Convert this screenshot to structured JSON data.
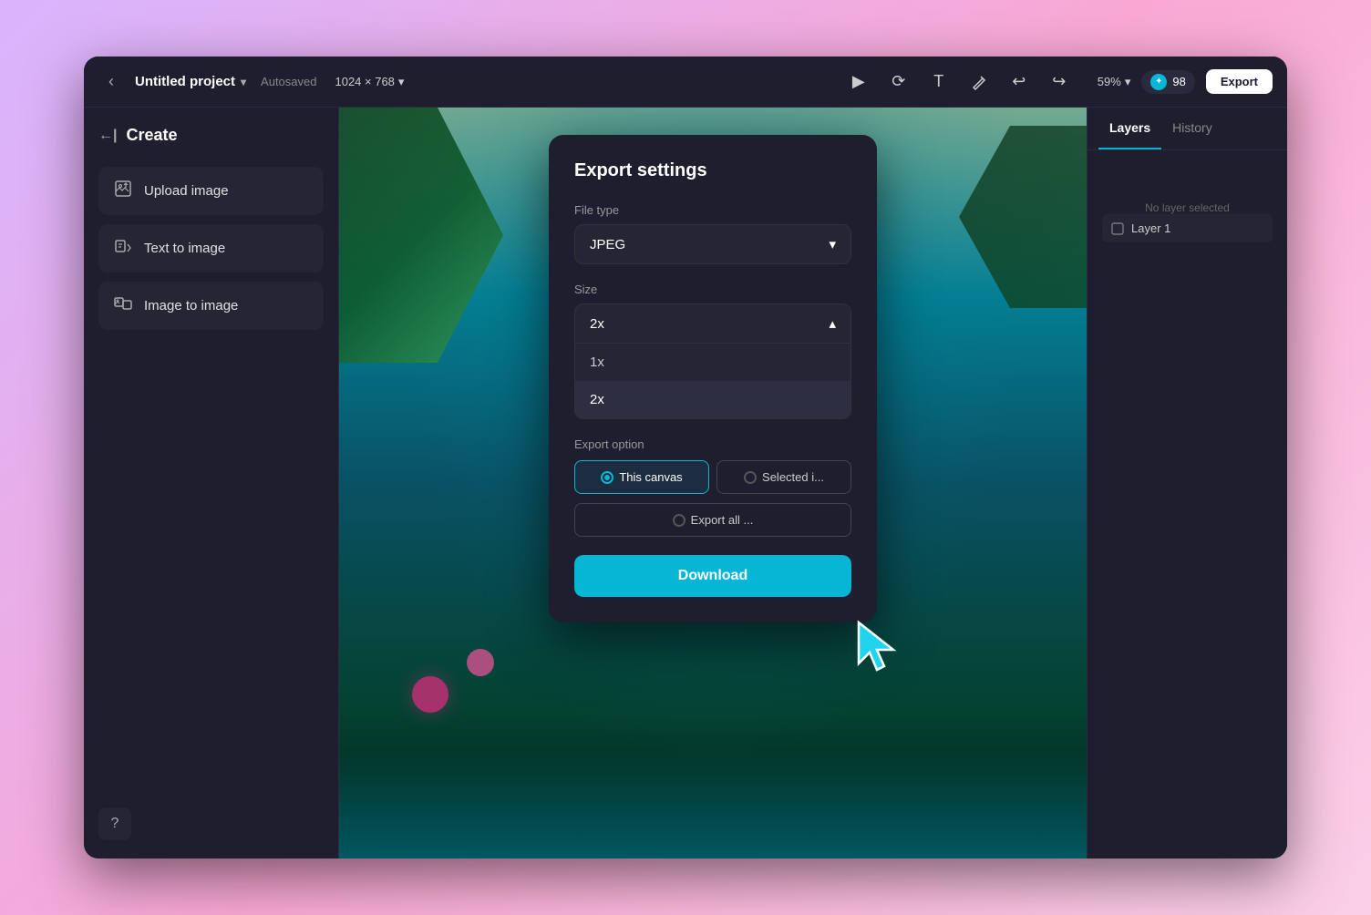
{
  "window": {
    "title": "Untitled project",
    "autosaved": "Autosaved",
    "dimensions": "1024 × 768",
    "zoom": "59%",
    "credits": "98",
    "export_btn": "Export"
  },
  "tools": {
    "select": "▶",
    "rotate": "↺",
    "text": "T",
    "pen": "✏",
    "undo": "↩",
    "redo": "↪"
  },
  "sidebar": {
    "header": "Create",
    "items": [
      {
        "label": "Upload image",
        "icon": "⬆"
      },
      {
        "label": "Text to image",
        "icon": "⟶"
      },
      {
        "label": "Image to image",
        "icon": "⊞"
      }
    ],
    "help_icon": "?"
  },
  "right_panel": {
    "tabs": [
      "Layers",
      "History"
    ],
    "active_tab": "Layers",
    "no_layer_text": "No layer selected",
    "layer_item": "Layer 1"
  },
  "export_modal": {
    "title": "Export settings",
    "file_type_label": "File type",
    "file_type_value": "JPEG",
    "file_type_chevron": "▾",
    "size_label": "Size",
    "size_value": "2x",
    "size_chevron": "▴",
    "size_options": [
      "1x",
      "2x"
    ],
    "export_option_label": "Export option",
    "option_this_canvas": "This canvas",
    "option_selected": "Selected i...",
    "option_export_all": "Export all ...",
    "download_btn": "Download"
  }
}
